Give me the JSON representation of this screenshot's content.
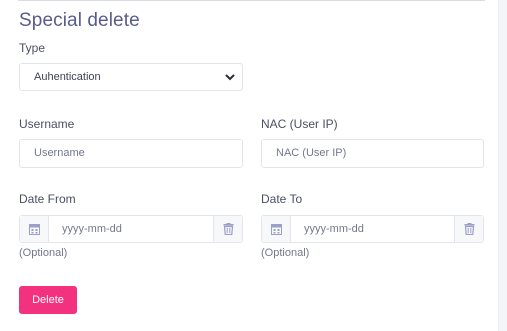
{
  "form": {
    "title": "Special delete",
    "type_label": "Type",
    "type_value": "Auhentication",
    "username_label": "Username",
    "username_placeholder": "Username",
    "nac_label": "NAC (User IP)",
    "nac_placeholder": "NAC (User IP)",
    "date_from_label": "Date From",
    "date_from_placeholder": "yyyy-mm-dd",
    "date_from_hint": "(Optional)",
    "date_to_label": "Date To",
    "date_to_placeholder": "yyyy-mm-dd",
    "date_to_hint": "(Optional)",
    "delete_label": "Delete"
  },
  "colors": {
    "title": "#575c8a",
    "button": "#f2327f",
    "icon": "#9aa0c6"
  }
}
